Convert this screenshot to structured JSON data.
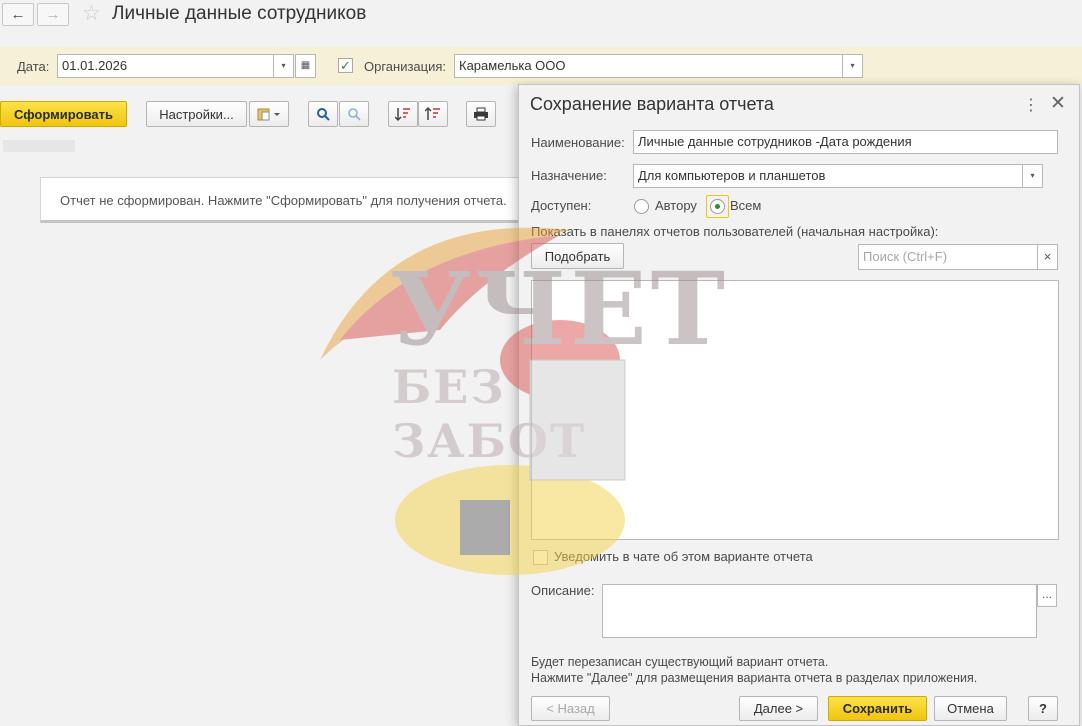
{
  "window": {
    "title": "Личные данные сотрудников"
  },
  "icons": {
    "back": "←",
    "forward": "→",
    "star": "☆",
    "dropdown": "▾",
    "calendar": "▦",
    "check": "✓",
    "print": "⎙",
    "search": "⌕",
    "more": "⋮",
    "close": "✕",
    "clear": "×",
    "ellipsis": "..."
  },
  "filters": {
    "date_label": "Дата:",
    "date_value": "01.01.2026",
    "org_label": "Организация:",
    "org_value": "Карамелька ООО",
    "org_checked": true
  },
  "toolbar": {
    "generate_label": "Сформировать",
    "settings_label": "Настройки..."
  },
  "main": {
    "message": "Отчет не сформирован. Нажмите \"Сформировать\" для получения отчета."
  },
  "dialog": {
    "title": "Сохранение варианта отчета",
    "name_label": "Наименование:",
    "name_value": "Личные данные сотрудников -Дата рождения",
    "purpose_label": "Назначение:",
    "purpose_value": "Для компьютеров и планшетов",
    "access_label": "Доступен:",
    "access_options": [
      "Автору",
      "Всем"
    ],
    "access_selected": "Всем",
    "panels_label": "Показать в панелях отчетов пользователей (начальная настройка):",
    "pick_label": "Подобрать",
    "search_placeholder": "Поиск (Ctrl+F)",
    "notify_label": "Уведомить в чате об этом варианте отчета",
    "notify_checked": false,
    "description_label": "Описание:",
    "description_value": "",
    "info_line1": "Будет перезаписан существующий вариант отчета.",
    "info_line2": "Нажмите \"Далее\" для размещения варианта отчета в разделах приложения.",
    "back_label": "< Назад",
    "next_label": "Далее >",
    "save_label": "Сохранить",
    "cancel_label": "Отмена",
    "help_label": "?"
  },
  "watermark": {
    "line1": "УЧЕТ",
    "line2": "БЕЗ ЗАБОТ"
  },
  "colors": {
    "primary_button": "#f1c40f",
    "filter_background": "#f6f1d6",
    "radio_selected": "#2e8b2e"
  }
}
